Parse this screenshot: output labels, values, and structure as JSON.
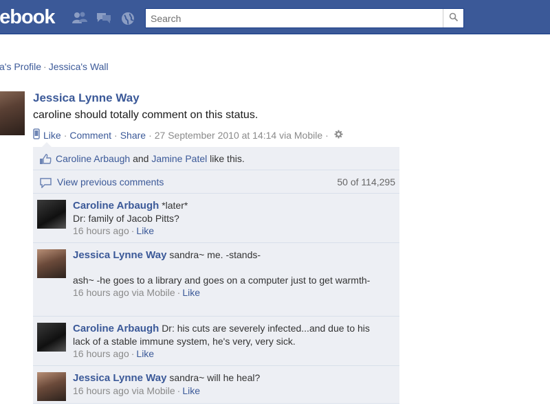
{
  "header": {
    "logo_text": "cebook",
    "search": {
      "placeholder": "Search",
      "value": ""
    },
    "icons": [
      "friend-requests-icon",
      "messages-icon",
      "notifications-icon",
      "search-icon"
    ],
    "colors": {
      "brand_blue": "#3b5998",
      "link_blue": "#3b5998",
      "feedback_bg": "#edeff4"
    }
  },
  "breadcrumb": {
    "profile": "ca's Profile",
    "separator": "·",
    "wall": "Jessica's Wall"
  },
  "post": {
    "author": "Jessica Lynne Way",
    "text": "caroline should totally comment on this status.",
    "actions": {
      "like": "Like",
      "comment": "Comment",
      "share": "Share",
      "timestamp": "27 September 2010 at 14:14 via Mobile"
    }
  },
  "feedback": {
    "likes": {
      "user1": "Caroline Arbaugh",
      "and": "and",
      "user2": "Jamine Patel",
      "suffix": "like this."
    },
    "previous": {
      "link": "View previous comments",
      "count": "50 of 114,295"
    },
    "comments": [
      {
        "author": "Caroline Arbaugh",
        "text_inline": "*later*",
        "text_lines": [
          "Dr: family of Jacob Pitts?"
        ],
        "time": "16 hours ago",
        "like": "Like"
      },
      {
        "author": "Jessica Lynne Way",
        "text_inline": "sandra~ me. -stands-",
        "text_lines": [
          "",
          "ash~ -he goes to a library and goes on a computer just to get warmth-"
        ],
        "time": "16 hours ago via Mobile",
        "like": "Like"
      },
      {
        "author": "Caroline Arbaugh",
        "text_inline": "Dr: his cuts are severely infected...and due to his lack of a stable immune system, he's very, very sick.",
        "text_lines": [],
        "time": "16 hours ago",
        "like": "Like"
      },
      {
        "author": "Jessica Lynne Way",
        "text_inline": "sandra~ will he heal?",
        "text_lines": [],
        "time": "16 hours ago via Mobile",
        "like": "Like"
      }
    ]
  }
}
